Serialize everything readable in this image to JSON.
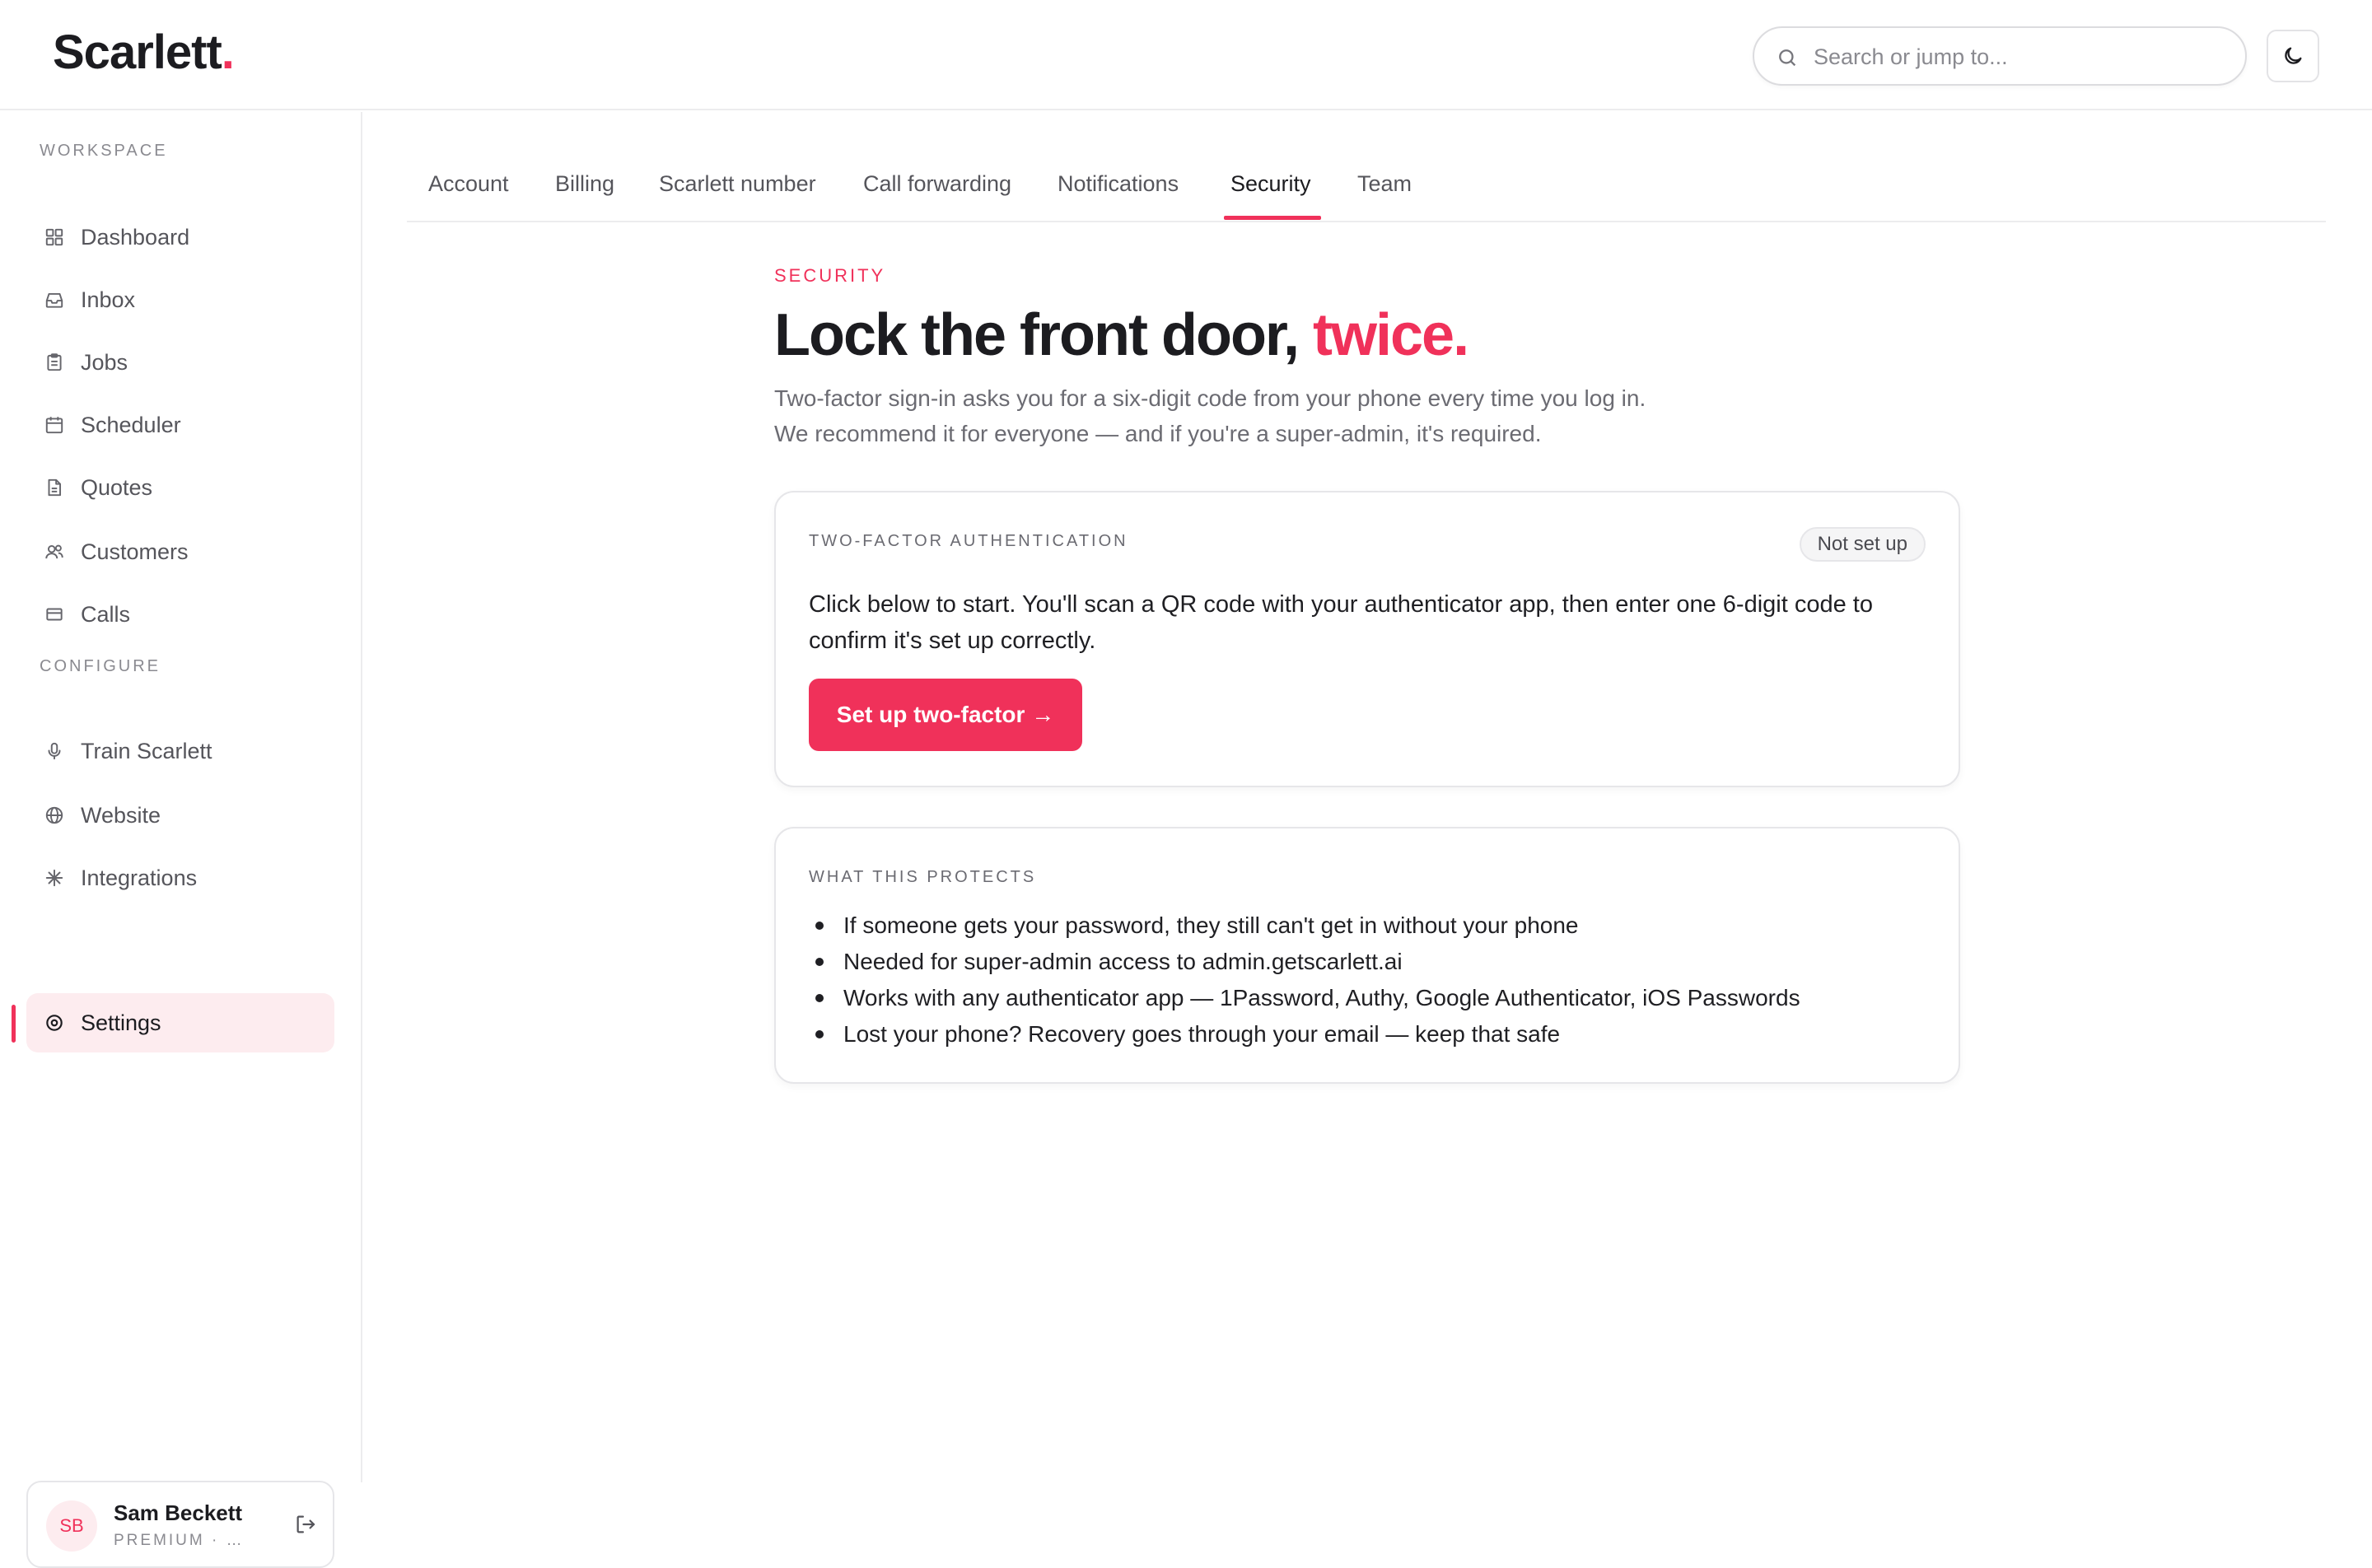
{
  "app": {
    "logo_text": "Scarlett",
    "logo_dot": ".",
    "accent_color": "#f0315a"
  },
  "header": {
    "search_placeholder": "Search or jump to...",
    "search_icon": "search-icon",
    "theme_icon": "moon-icon"
  },
  "sidebar": {
    "workspace_label": "WORKSPACE",
    "workspace_items": [
      {
        "label": "Dashboard",
        "icon": "grid-icon"
      },
      {
        "label": "Inbox",
        "icon": "inbox-icon"
      },
      {
        "label": "Jobs",
        "icon": "clipboard-icon"
      },
      {
        "label": "Scheduler",
        "icon": "calendar-icon"
      },
      {
        "label": "Quotes",
        "icon": "document-icon"
      },
      {
        "label": "Customers",
        "icon": "users-icon"
      },
      {
        "label": "Calls",
        "icon": "card-icon"
      }
    ],
    "configure_label": "CONFIGURE",
    "configure_items": [
      {
        "label": "Train Scarlett",
        "icon": "microphone-icon"
      },
      {
        "label": "Website",
        "icon": "globe-icon"
      },
      {
        "label": "Integrations",
        "icon": "asterisk-icon"
      },
      {
        "label": "Settings",
        "icon": "settings-icon",
        "active": true
      }
    ],
    "user": {
      "initials": "SB",
      "name": "Sam Beckett",
      "plan": "PREMIUM · S...",
      "logout_icon": "logout-icon"
    }
  },
  "tabs": [
    {
      "label": "Account"
    },
    {
      "label": "Billing"
    },
    {
      "label": "Scarlett number"
    },
    {
      "label": "Call forwarding"
    },
    {
      "label": "Notifications"
    },
    {
      "label": "Security",
      "active": true
    },
    {
      "label": "Team"
    }
  ],
  "main": {
    "eyebrow": "SECURITY",
    "headline": "Lock the front door, ",
    "headline_accent": "twice.",
    "lede": "Two-factor sign-in asks you for a six-digit code from your phone every time you log in. We recommend it for everyone — and if you're a super-admin, it's required.",
    "two_factor_card": {
      "label": "TWO-FACTOR AUTHENTICATION",
      "status": "Not set up",
      "body": "Click below to start. You'll scan a QR code with your authenticator app, then enter one 6-digit code to confirm it's set up correctly.",
      "button": "Set up two-factor →"
    },
    "protects_card": {
      "label": "WHAT THIS PROTECTS",
      "items": [
        "If someone gets your password, they still can't get in without your phone",
        "Needed for super-admin access to admin.getscarlett.ai",
        "Works with any authenticator app — 1Password, Authy, Google Authenticator, iOS Passwords",
        "Lost your phone? Recovery goes through your email — keep that safe"
      ]
    }
  }
}
